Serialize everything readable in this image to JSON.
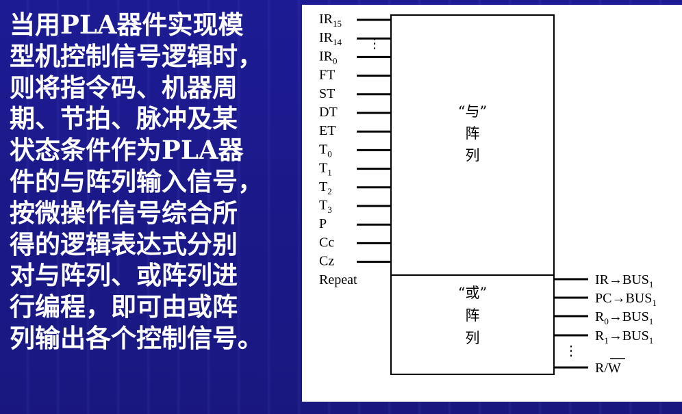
{
  "description": {
    "lines": [
      "当用PLA器件实现模",
      "型机控制信号逻辑时，",
      "则将指令码、机器周",
      "期、节拍、脉冲及某",
      "状态条件作为PLA器",
      "件的与阵列输入信号，",
      "按微操作信号综合所",
      "得的逻辑表达式分别",
      "对与阵列、或阵列进",
      "行编程，即可由或阵",
      "列输出各个控制信号。"
    ]
  },
  "diagram": {
    "inputs": [
      {
        "main": "IR",
        "sub": "15"
      },
      {
        "main": "IR",
        "sub": "14"
      },
      {
        "main": "IR",
        "sub": "0"
      },
      {
        "main": "FT",
        "sub": ""
      },
      {
        "main": "ST",
        "sub": ""
      },
      {
        "main": "DT",
        "sub": ""
      },
      {
        "main": "ET",
        "sub": ""
      },
      {
        "main": "T",
        "sub": "0"
      },
      {
        "main": "T",
        "sub": "1"
      },
      {
        "main": "T",
        "sub": "2"
      },
      {
        "main": "T",
        "sub": "3"
      },
      {
        "main": "P",
        "sub": ""
      },
      {
        "main": "Cc",
        "sub": ""
      },
      {
        "main": "Cz",
        "sub": ""
      },
      {
        "main": "Repeat",
        "sub": ""
      }
    ],
    "input_ellipsis": "⋮",
    "and_array": {
      "quote_label": "“与”",
      "line2": "阵",
      "line3": "列"
    },
    "or_array": {
      "quote_label": "“或”",
      "line2": "阵",
      "line3": "列"
    },
    "outputs": [
      {
        "pre": "IR",
        "pre_sub": "",
        "arrow": "→",
        "post": "BUS",
        "post_sub": "1"
      },
      {
        "pre": "PC",
        "pre_sub": "",
        "arrow": "→",
        "post": "BUS",
        "post_sub": "1"
      },
      {
        "pre": "R",
        "pre_sub": "0",
        "arrow": "→",
        "post": "BUS",
        "post_sub": "1"
      },
      {
        "pre": "R",
        "pre_sub": "1",
        "arrow": "→",
        "post": "BUS",
        "post_sub": "1"
      }
    ],
    "output_ellipsis": "⋮",
    "last_output": {
      "pre": "R/",
      "overbar": "W"
    }
  }
}
